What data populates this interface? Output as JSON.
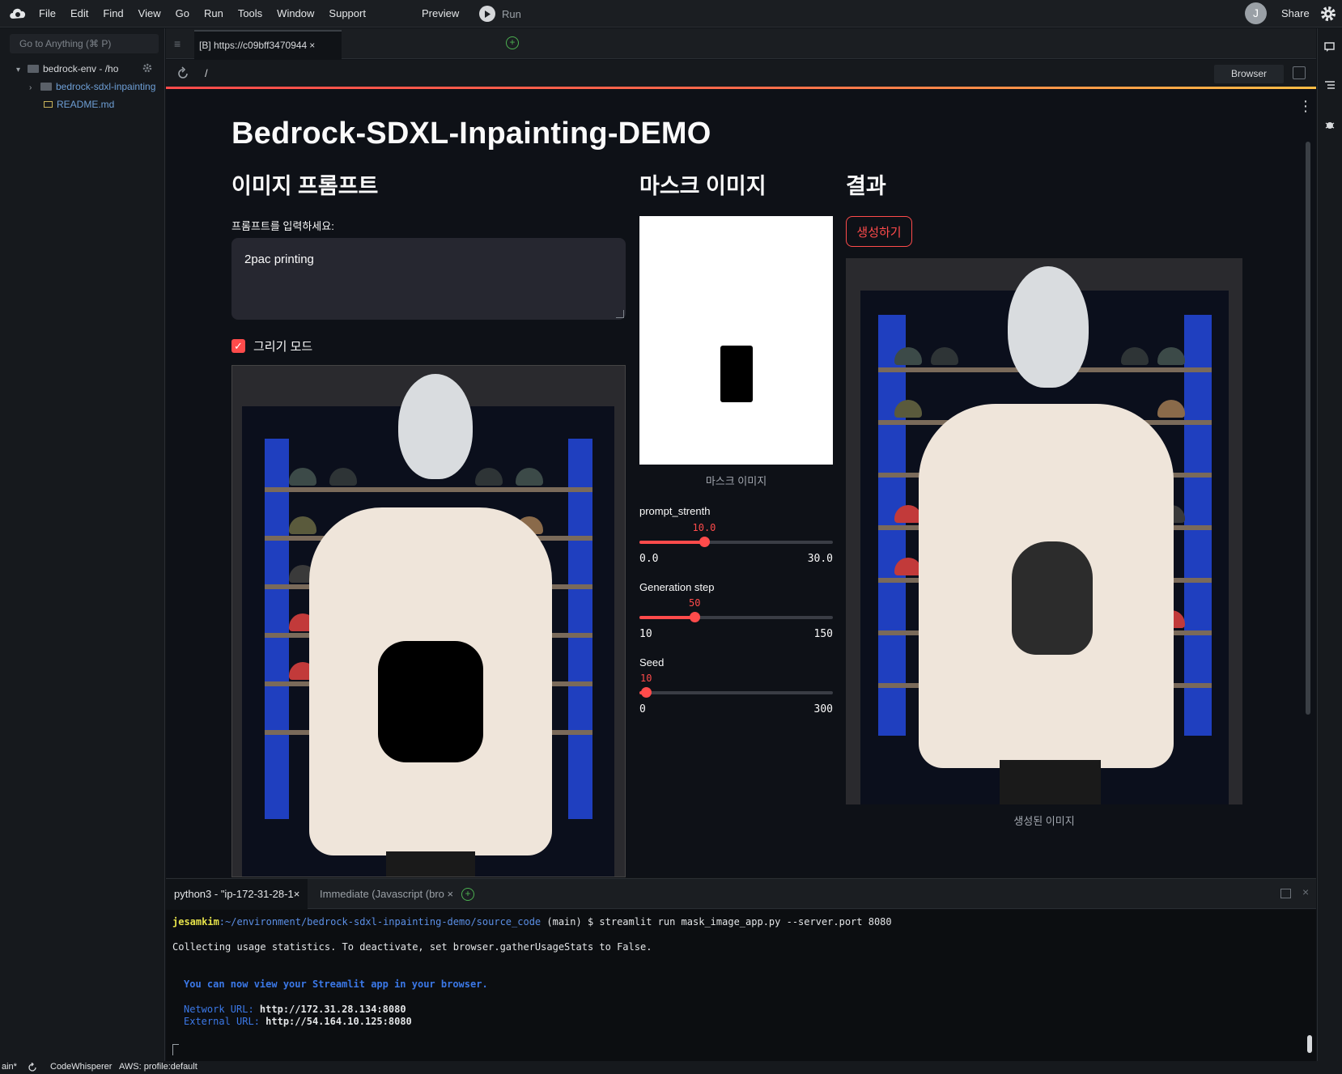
{
  "menubar": {
    "items": [
      "File",
      "Edit",
      "Find",
      "View",
      "Go",
      "Run",
      "Tools",
      "Window",
      "Support"
    ],
    "preview": "Preview",
    "run": "Run",
    "avatar": "J",
    "share": "Share"
  },
  "sidebar": {
    "goto_placeholder": "Go to Anything (⌘ P)",
    "root": "bedrock-env - /ho",
    "folder": "bedrock-sdxl-inpainting",
    "file": "README.md"
  },
  "editor": {
    "tab_title": "[B] https://c09bff3470944",
    "url_path": "/",
    "browser_label": "Browser"
  },
  "app": {
    "title": "Bedrock-SDXL-Inpainting-DEMO",
    "col1_header": "이미지 프롬프트",
    "prompt_label": "프롬프트를 입력하세요:",
    "prompt_value": "2pac printing",
    "draw_mode_label": "그리기 모드",
    "draw_mode_checked": true,
    "col2_header": "마스크 이미지",
    "mask_caption": "마스크 이미지",
    "sliders": [
      {
        "label": "prompt_strenth",
        "value": "10.0",
        "min": "0.0",
        "max": "30.0",
        "fraction": 0.333
      },
      {
        "label": "Generation step",
        "value": "50",
        "min": "10",
        "max": "150",
        "fraction": 0.286
      },
      {
        "label": "Seed",
        "value": "10",
        "min": "0",
        "max": "300",
        "fraction": 0.033
      }
    ],
    "col3_header": "결과",
    "generate_button": "생성하기",
    "result_caption": "생성된 이미지",
    "accent_color": "#ff4b4b"
  },
  "terminal": {
    "tabs": [
      "python3 - \"ip-172-31-28-1",
      "Immediate (Javascript (bro"
    ],
    "user": "jesamkim",
    "path": ":~/environment/bedrock-sdxl-inpainting-demo/source_code",
    "command": " (main) $ streamlit run mask_image_app.py --server.port 8080",
    "line2": "Collecting usage statistics. To deactivate, set browser.gatherUsageStats to False.",
    "line3": "You can now view your Streamlit app in your browser.",
    "network_label": "Network URL: ",
    "network_url": "http://172.31.28.134:8080",
    "external_label": "External URL: ",
    "external_url": "http://54.164.10.125:8080"
  },
  "statusbar": {
    "branch": "ain*",
    "codewhisperer": "CodeWhisperer",
    "aws": "AWS: profile:default"
  }
}
